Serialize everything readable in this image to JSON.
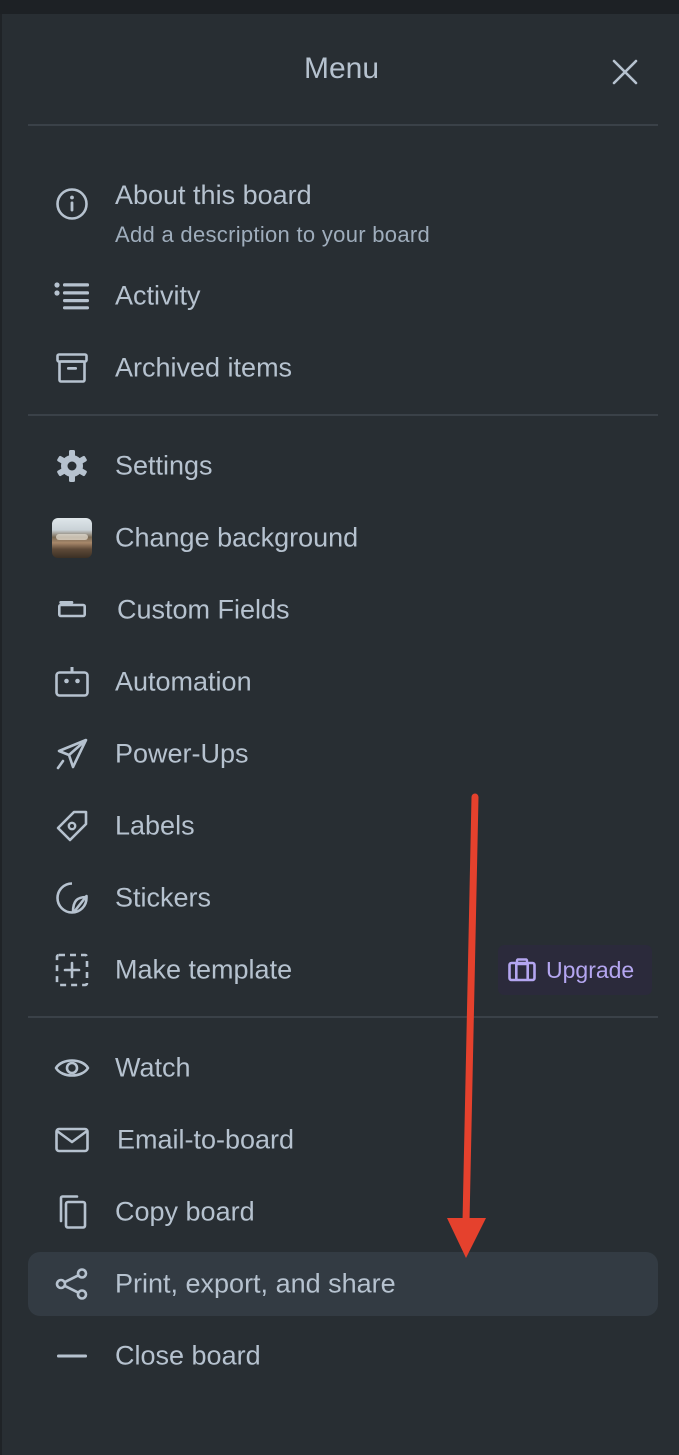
{
  "menu": {
    "title": "Menu",
    "items": [
      {
        "label": "About this board",
        "sublabel": "Add a description to your board",
        "icon": "info-icon"
      },
      {
        "label": "Activity",
        "icon": "activity-list-icon"
      },
      {
        "label": "Archived items",
        "icon": "archive-icon"
      },
      {
        "label": "Settings",
        "icon": "gear-icon"
      },
      {
        "label": "Change background",
        "icon": "background-thumbnail"
      },
      {
        "label": "Custom Fields",
        "icon": "custom-fields-icon"
      },
      {
        "label": "Automation",
        "icon": "robot-icon"
      },
      {
        "label": "Power-Ups",
        "icon": "rocket-icon"
      },
      {
        "label": "Labels",
        "icon": "tag-icon"
      },
      {
        "label": "Stickers",
        "icon": "sticker-icon"
      },
      {
        "label": "Make template",
        "icon": "template-add-icon",
        "badge": "Upgrade"
      },
      {
        "label": "Watch",
        "icon": "eye-icon"
      },
      {
        "label": "Email-to-board",
        "icon": "mail-icon"
      },
      {
        "label": "Copy board",
        "icon": "copy-icon"
      },
      {
        "label": "Print, export, and share",
        "icon": "share-icon",
        "active": true
      },
      {
        "label": "Close board",
        "icon": "minus-icon"
      }
    ]
  },
  "colors": {
    "background": "#282e33",
    "text": "#b6c2cf",
    "upgrade_accent": "#b4a6f0",
    "annotation_arrow": "#e5412d"
  }
}
